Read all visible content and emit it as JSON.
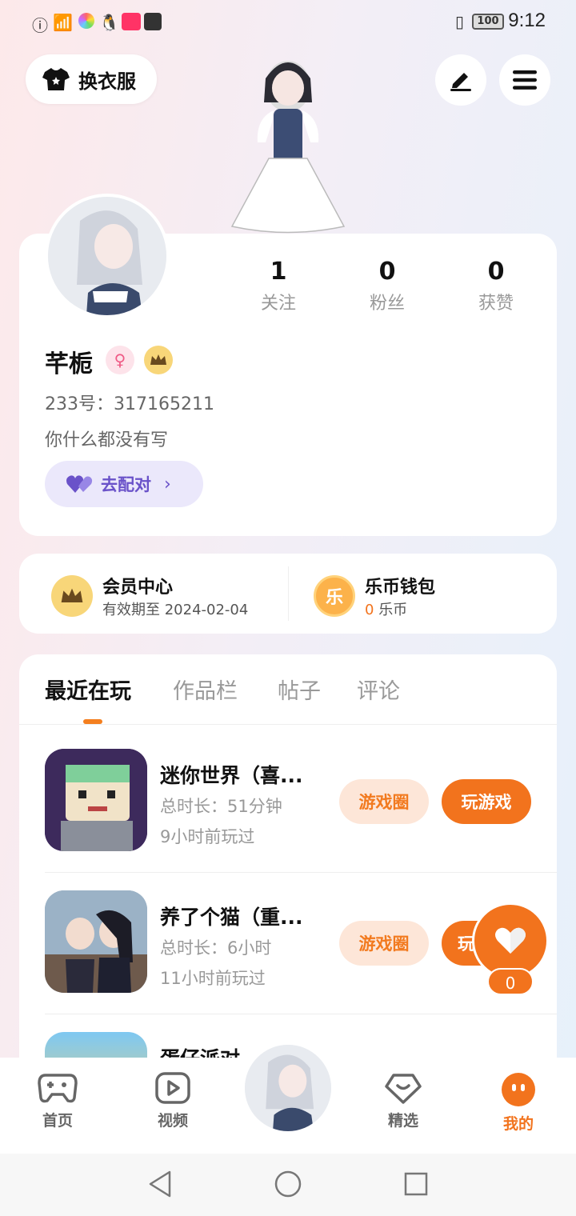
{
  "status_bar": {
    "time": "9:12",
    "battery": "100"
  },
  "header": {
    "outfit_label": "换衣服",
    "edit_icon": "pen-icon",
    "menu_icon": "hamburger-icon"
  },
  "profile": {
    "stats": [
      {
        "num": "1",
        "label": "关注"
      },
      {
        "num": "0",
        "label": "粉丝"
      },
      {
        "num": "0",
        "label": "获赞"
      }
    ],
    "username": "芊栀",
    "uid": "233号：317165211",
    "bio": "你什么都没有写",
    "match_label": "去配对"
  },
  "member": {
    "title": "会员中心",
    "sub": "有效期至 2024-02-04"
  },
  "wallet": {
    "title": "乐币钱包",
    "amount": "0",
    "unit": "乐币",
    "icon_char": "乐"
  },
  "tabs": [
    "最近在玩",
    "作品栏",
    "帖子",
    "评论"
  ],
  "games": [
    {
      "name": "迷你世界（喜...",
      "duration": "总时长：51分钟",
      "last_played": "9小时前玩过",
      "circle_label": "游戏圈",
      "play_label": "玩游戏"
    },
    {
      "name": "养了个猫（重...",
      "duration": "总时长：6小时",
      "last_played": "11小时前玩过",
      "circle_label": "游戏圈",
      "play_label": "玩"
    },
    {
      "name": "蛋仔派对"
    }
  ],
  "float_like": {
    "count": "0"
  },
  "nav": [
    {
      "label": "首页"
    },
    {
      "label": "视频"
    },
    {
      "label": "精选"
    },
    {
      "label": "我的"
    }
  ],
  "colors": {
    "accent": "#f2731d",
    "purple": "#6a52c9"
  }
}
